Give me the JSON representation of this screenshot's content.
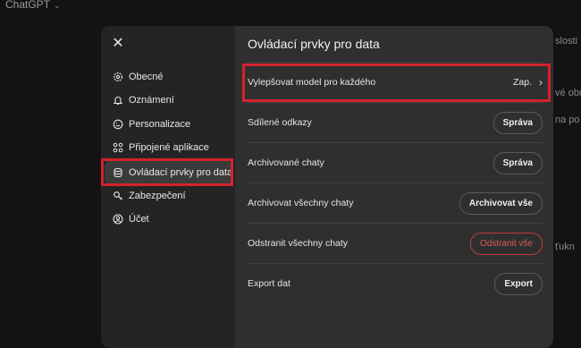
{
  "app": {
    "title": "ChatGPT"
  },
  "background": {
    "fragments": [
      "slosti",
      "vé obr",
      "na po",
      "ťukn"
    ]
  },
  "settings": {
    "sidebar": {
      "items": [
        {
          "label": "Obecné",
          "icon": "gear-icon"
        },
        {
          "label": "Oznámení",
          "icon": "bell-icon"
        },
        {
          "label": "Personalizace",
          "icon": "personalization-icon"
        },
        {
          "label": "Připojené aplikace",
          "icon": "apps-grid-icon"
        },
        {
          "label": "Ovládací prvky pro data",
          "icon": "database-icon",
          "active": true
        },
        {
          "label": "Zabezpečení",
          "icon": "shield-key-icon"
        },
        {
          "label": "Účet",
          "icon": "account-icon"
        }
      ]
    },
    "content": {
      "title": "Ovládací prvky pro data",
      "rows": [
        {
          "label": "Vylepšovat model pro každého",
          "value": "Zap."
        },
        {
          "label": "Sdílené odkazy",
          "button": "Správa"
        },
        {
          "label": "Archivované chaty",
          "button": "Správa"
        },
        {
          "label": "Archivovat všechny chaty",
          "button": "Archivovat vše"
        },
        {
          "label": "Odstranit všechny chaty",
          "button": "Odstranit vše"
        },
        {
          "label": "Export dat",
          "button": "Export"
        }
      ]
    }
  },
  "colors": {
    "highlight": "#d3222d",
    "danger": "#e05a5e"
  }
}
